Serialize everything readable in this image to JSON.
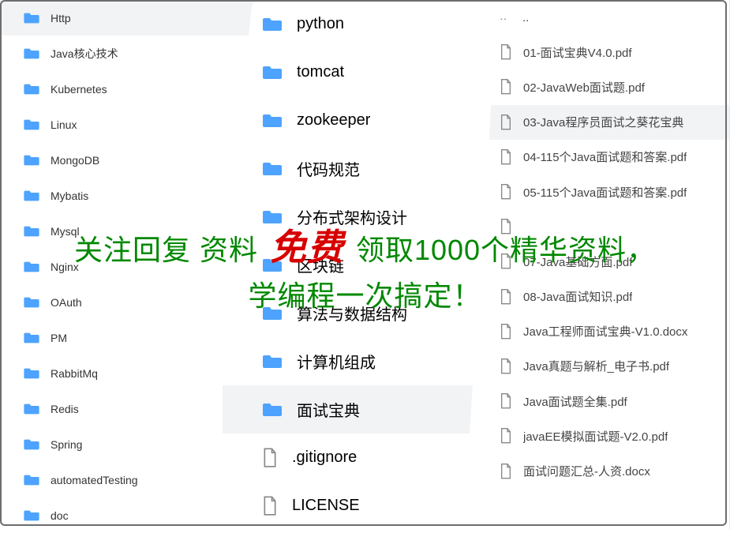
{
  "panels": {
    "left": {
      "items": [
        {
          "type": "folder",
          "label": "Http",
          "selected": true
        },
        {
          "type": "folder",
          "label": "Java核心技术"
        },
        {
          "type": "folder",
          "label": "Kubernetes"
        },
        {
          "type": "folder",
          "label": "Linux"
        },
        {
          "type": "folder",
          "label": "MongoDB"
        },
        {
          "type": "folder",
          "label": "Mybatis"
        },
        {
          "type": "folder",
          "label": "Mysql"
        },
        {
          "type": "folder",
          "label": "Nginx"
        },
        {
          "type": "folder",
          "label": "OAuth"
        },
        {
          "type": "folder",
          "label": "PM"
        },
        {
          "type": "folder",
          "label": "RabbitMq"
        },
        {
          "type": "folder",
          "label": "Redis"
        },
        {
          "type": "folder",
          "label": "Spring"
        },
        {
          "type": "folder",
          "label": "automatedTesting"
        },
        {
          "type": "folder",
          "label": "doc"
        }
      ]
    },
    "middle": {
      "items": [
        {
          "type": "folder",
          "label": "python"
        },
        {
          "type": "folder",
          "label": "tomcat"
        },
        {
          "type": "folder",
          "label": "zookeeper"
        },
        {
          "type": "folder",
          "label": "代码规范"
        },
        {
          "type": "folder",
          "label": "分布式架构设计"
        },
        {
          "type": "folder",
          "label": "区块链"
        },
        {
          "type": "folder",
          "label": "算法与数据结构"
        },
        {
          "type": "folder",
          "label": "计算机组成"
        },
        {
          "type": "folder",
          "label": "面试宝典",
          "selected": true
        },
        {
          "type": "file",
          "label": ".gitignore"
        },
        {
          "type": "file",
          "label": "LICENSE"
        }
      ]
    },
    "right": {
      "items": [
        {
          "type": "up",
          "label": ".."
        },
        {
          "type": "file",
          "label": "01-面试宝典V4.0.pdf"
        },
        {
          "type": "file",
          "label": "02-JavaWeb面试题.pdf"
        },
        {
          "type": "file",
          "label": "03-Java程序员面试之葵花宝典",
          "selected": true
        },
        {
          "type": "file",
          "label": "04-115个Java面试题和答案.pdf"
        },
        {
          "type": "file",
          "label": "05-115个Java面试题和答案.pdf"
        },
        {
          "type": "file",
          "label": ""
        },
        {
          "type": "file",
          "label": "07-Java基础方面.pdf"
        },
        {
          "type": "file",
          "label": "08-Java面试知识.pdf"
        },
        {
          "type": "file",
          "label": "Java工程师面试宝典-V1.0.docx"
        },
        {
          "type": "file",
          "label": "Java真题与解析_电子书.pdf"
        },
        {
          "type": "file",
          "label": "Java面试题全集.pdf"
        },
        {
          "type": "file",
          "label": "javaEE模拟面试题-V2.0.pdf"
        },
        {
          "type": "file",
          "label": "面试问题汇总-人资.docx"
        }
      ]
    }
  },
  "overlay": {
    "pre": "关注回复 资料 ",
    "highlight": "免费",
    "post": " 领取1000个精华资料，",
    "line2": "学编程一次搞定！"
  },
  "icons": {
    "folder_color": "#4da3ff",
    "file_stroke": "#888"
  }
}
